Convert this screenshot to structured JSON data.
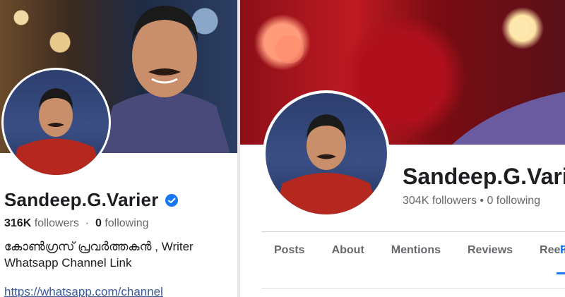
{
  "left_profile": {
    "name": "Sandeep.G.Varier",
    "verified_icon": "verified-badge-icon",
    "followers_count": "316K",
    "followers_label": "followers",
    "separator": "·",
    "following_count": "0",
    "following_label": "following",
    "bio_line1": "കോൺഗ്രസ് പ്രവർത്തകൻ , Writer",
    "bio_line2": "Whatsapp Channel Link",
    "link": "https://whatsapp.com/channel"
  },
  "right_profile": {
    "name": "Sandeep.G.Vari",
    "followers_text": "304K followers • 0 following",
    "tabs": [
      "Posts",
      "About",
      "Mentions",
      "Reviews",
      "Reels"
    ],
    "tab_more": "R"
  },
  "colors": {
    "link": "#385898",
    "accent": "#1877f2",
    "text": "#1c1e21",
    "muted": "#65676b"
  }
}
